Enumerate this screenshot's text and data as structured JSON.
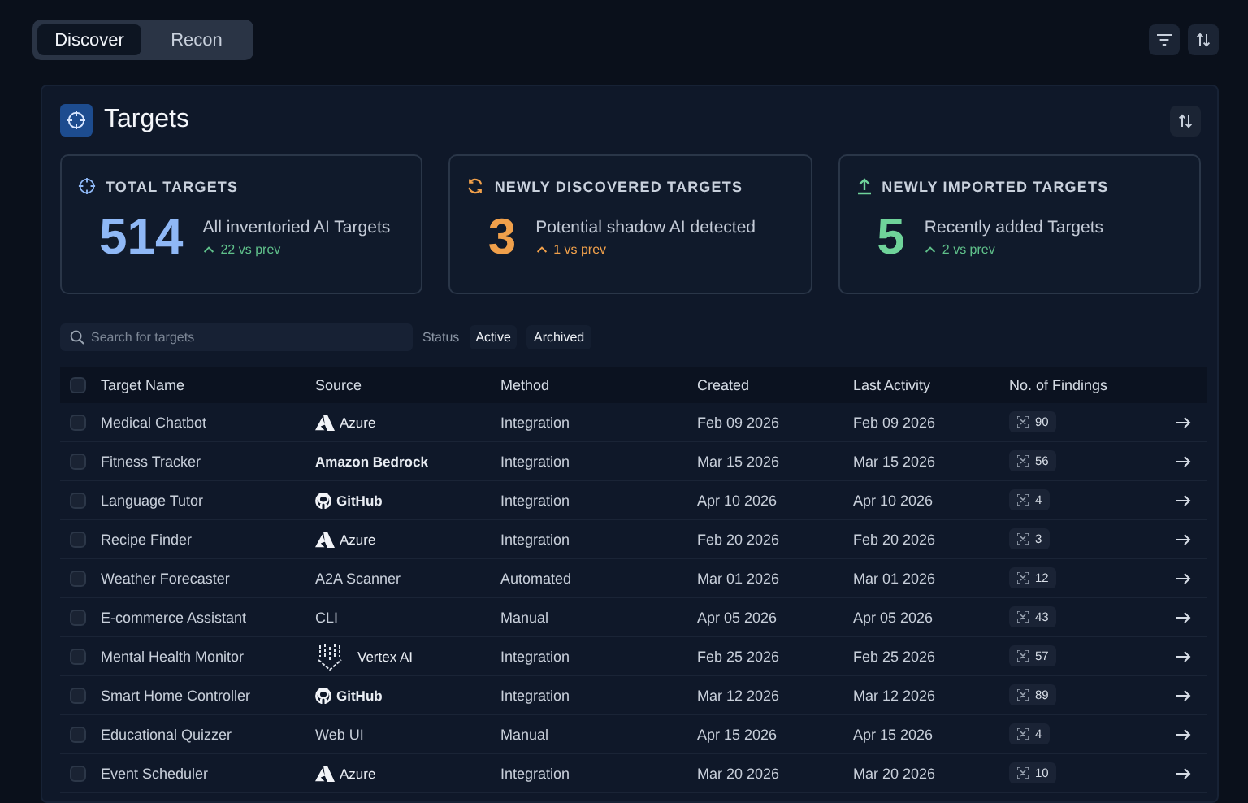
{
  "mode_tabs": [
    {
      "label": "Discover",
      "selected": true
    },
    {
      "label": "Recon",
      "selected": false
    }
  ],
  "panel": {
    "title": "Targets"
  },
  "stat_cards": [
    {
      "kind": "total",
      "label": "TOTAL TARGETS",
      "value": "514",
      "description": "All inventoried AI Targets",
      "delta": {
        "text": "22 vs prev",
        "color": "#5fbf8a"
      },
      "color": "#8fb8f6"
    },
    {
      "kind": "discovered",
      "label": "NEWLY DISCOVERED TARGETS",
      "value": "3",
      "description": "Potential shadow AI detected",
      "delta": {
        "text": "1 vs prev",
        "color": "#f0a04b"
      },
      "color": "#f0a04b"
    },
    {
      "kind": "imported",
      "label": "NEWLY IMPORTED TARGETS",
      "value": "5",
      "description": "Recently added Targets",
      "delta": {
        "text": "2 vs prev",
        "color": "#5fbf8a"
      },
      "color": "#6fd39a"
    }
  ],
  "search": {
    "placeholder": "Search for targets"
  },
  "status_filter": {
    "label": "Status",
    "options": [
      "Active",
      "Archived"
    ]
  },
  "table": {
    "header_checked": false,
    "columns": [
      "Target Name",
      "Source",
      "Method",
      "Created",
      "Last Activity",
      "No. of Findings"
    ],
    "rows": [
      {
        "checked": false,
        "name": "Medical Chatbot",
        "source": {
          "kind": "azure",
          "label": "Azure"
        },
        "method": "Integration",
        "created": "Feb 09 2026",
        "last_activity": "Feb 09 2026",
        "findings": "90"
      },
      {
        "checked": false,
        "name": "Fitness Tracker",
        "source": {
          "kind": "bedrock",
          "label": "Amazon Bedrock"
        },
        "method": "Integration",
        "created": "Mar 15 2026",
        "last_activity": "Mar 15 2026",
        "findings": "56"
      },
      {
        "checked": false,
        "name": "Language Tutor",
        "source": {
          "kind": "github",
          "label": "GitHub"
        },
        "method": "Integration",
        "created": "Apr 10 2026",
        "last_activity": "Apr 10 2026",
        "findings": "4"
      },
      {
        "checked": false,
        "name": "Recipe Finder",
        "source": {
          "kind": "azure",
          "label": "Azure"
        },
        "method": "Integration",
        "created": "Feb 20 2026",
        "last_activity": "Feb 20 2026",
        "findings": "3"
      },
      {
        "checked": false,
        "name": "Weather Forecaster",
        "source": {
          "kind": "plain",
          "label": "A2A Scanner"
        },
        "method": "Automated",
        "created": "Mar 01 2026",
        "last_activity": "Mar 01 2026",
        "findings": "12"
      },
      {
        "checked": false,
        "name": "E-commerce Assistant",
        "source": {
          "kind": "plain",
          "label": "CLI"
        },
        "method": "Manual",
        "created": "Apr 05 2026",
        "last_activity": "Apr 05 2026",
        "findings": "43"
      },
      {
        "checked": false,
        "name": "Mental Health Monitor",
        "source": {
          "kind": "vertex",
          "label": "Vertex AI"
        },
        "method": "Integration",
        "created": "Feb 25 2026",
        "last_activity": "Feb 25 2026",
        "findings": "57"
      },
      {
        "checked": false,
        "name": "Smart Home Controller",
        "source": {
          "kind": "github",
          "label": "GitHub"
        },
        "method": "Integration",
        "created": "Mar 12 2026",
        "last_activity": "Mar 12 2026",
        "findings": "89"
      },
      {
        "checked": false,
        "name": "Educational Quizzer",
        "source": {
          "kind": "plain",
          "label": "Web UI"
        },
        "method": "Manual",
        "created": "Apr 15 2026",
        "last_activity": "Apr 15 2026",
        "findings": "4"
      },
      {
        "checked": false,
        "name": "Event Scheduler",
        "source": {
          "kind": "azure",
          "label": "Azure"
        },
        "method": "Integration",
        "created": "Mar 20 2026",
        "last_activity": "Mar 20 2026",
        "findings": "10"
      }
    ]
  }
}
